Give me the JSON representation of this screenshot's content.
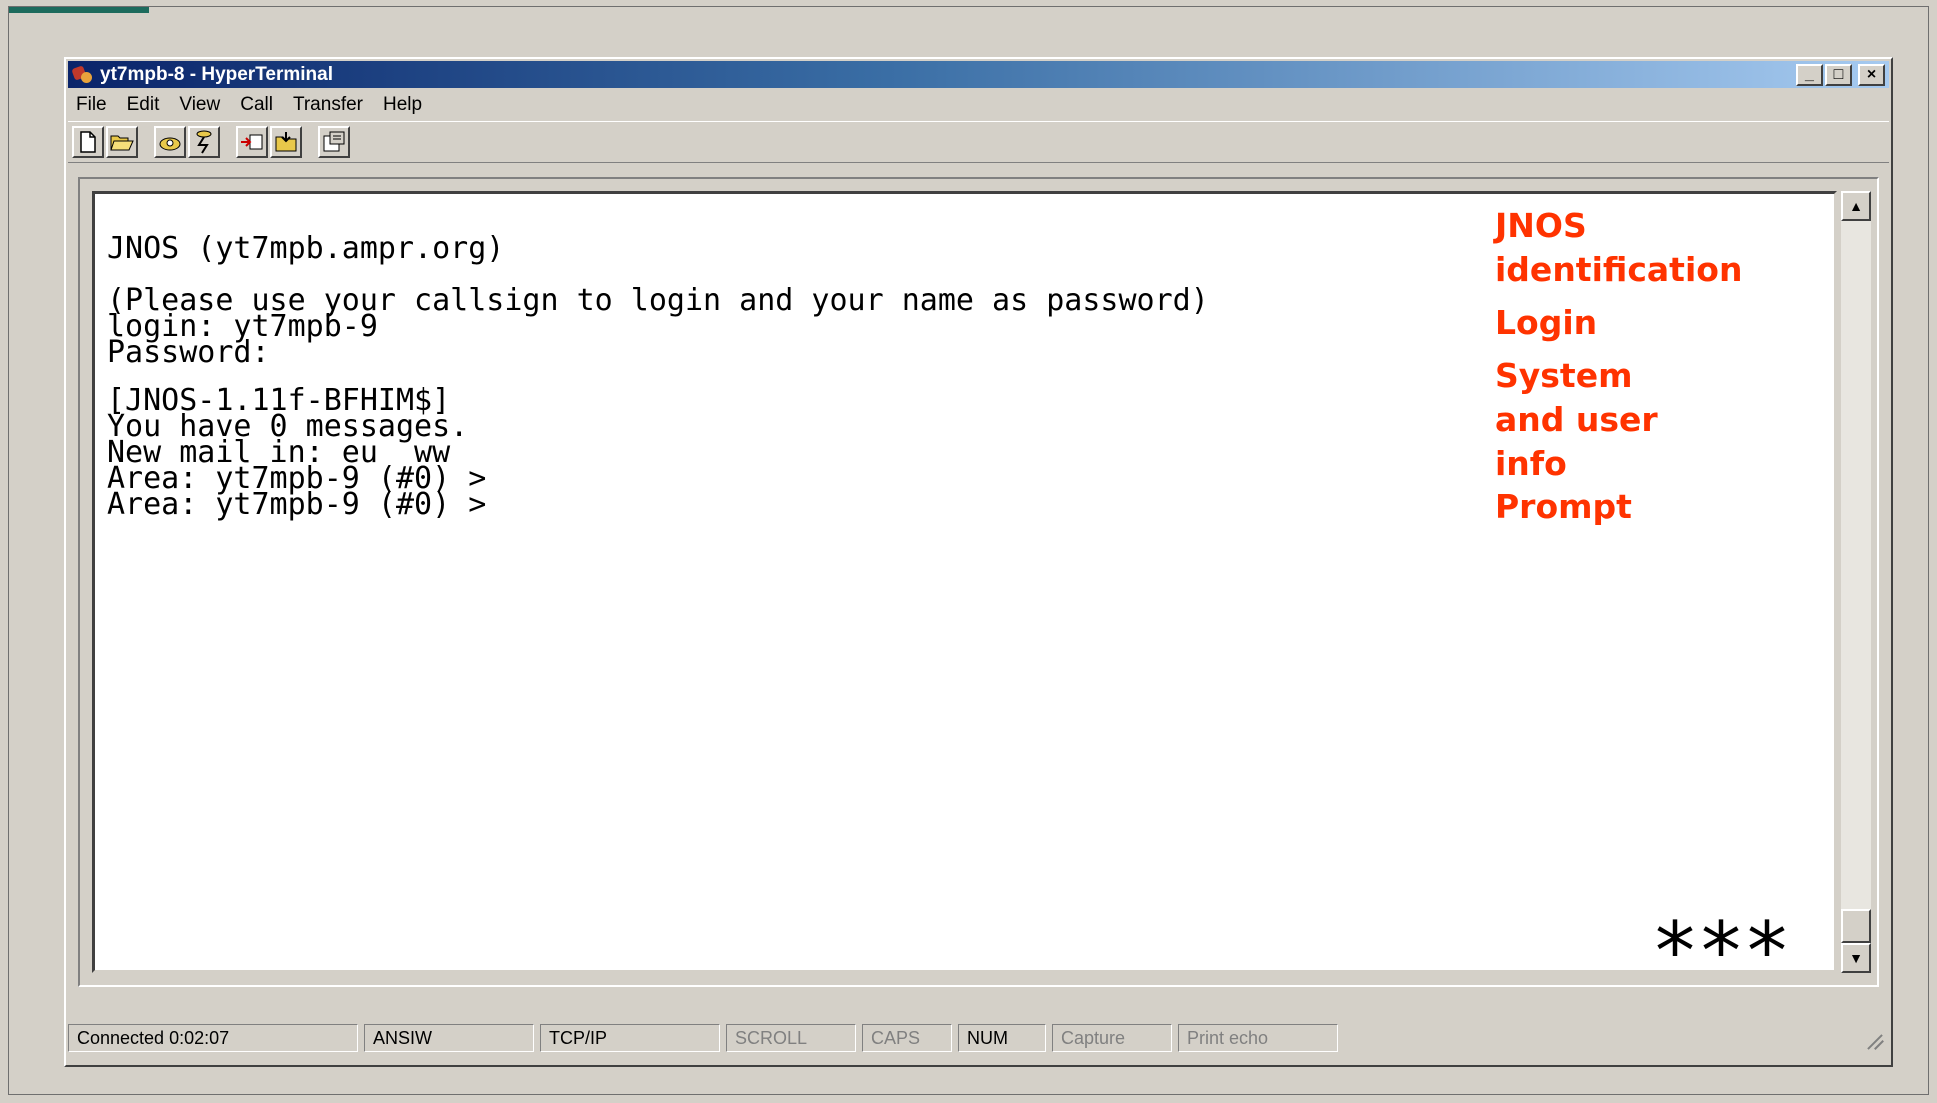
{
  "window": {
    "title": "yt7mpb-8 - HyperTerminal",
    "controls": {
      "minimize": "_",
      "maximize": "□",
      "close": "×"
    }
  },
  "menu": [
    "File",
    "Edit",
    "View",
    "Call",
    "Transfer",
    "Help"
  ],
  "toolbar": [
    {
      "name": "new-icon"
    },
    {
      "name": "open-icon"
    },
    {
      "name": "dial-icon"
    },
    {
      "name": "disconnect-icon"
    },
    {
      "name": "send-icon"
    },
    {
      "name": "receive-icon"
    },
    {
      "name": "properties-icon"
    }
  ],
  "terminal": {
    "lines": [
      "JNOS (yt7mpb.ampr.org)",
      "(Please use your callsign to login and your name as password)",
      "login: yt7mpb-9",
      "Password:",
      "[JNOS-1.11f-BFHIM$]",
      "You have 0 messages.",
      "New mail in: eu  ww",
      "Area: yt7mpb-9 (#0) >",
      "Area: yt7mpb-9 (#0) >"
    ]
  },
  "annotations": {
    "identification": [
      "JNOS",
      "identification"
    ],
    "login": "Login",
    "system": [
      "System",
      "and user",
      "info"
    ],
    "prompt": "Prompt",
    "stars": "***"
  },
  "status": {
    "connected": "Connected 0:02:07",
    "emulation": "ANSIW",
    "protocol": "TCP/IP",
    "scroll": "SCROLL",
    "caps": "CAPS",
    "num": "NUM",
    "capture": "Capture",
    "print_echo": "Print echo"
  },
  "colors": {
    "annotation": "#ff3300",
    "accent": "#1d6b5d",
    "titlebar": "#0a246a"
  }
}
